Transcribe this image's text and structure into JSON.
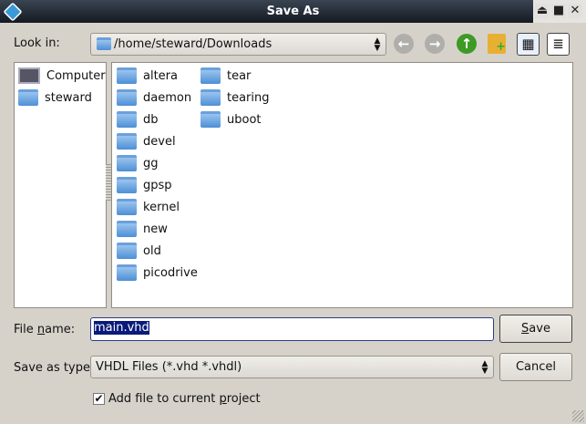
{
  "window": {
    "title": "Save As"
  },
  "look_in": {
    "label": "Look in:",
    "path": "/home/steward/Downloads"
  },
  "toolbar": {
    "back": "back-arrow-icon",
    "forward": "forward-arrow-icon",
    "up": "up-arrow-icon",
    "new_folder": "new-folder-icon",
    "icon_view": "grid-icon",
    "detail_view": "list-icon"
  },
  "places": [
    {
      "label": "Computer"
    },
    {
      "label": "steward"
    }
  ],
  "files": [
    {
      "name": "altera"
    },
    {
      "name": "daemon"
    },
    {
      "name": "db"
    },
    {
      "name": "devel"
    },
    {
      "name": "gg"
    },
    {
      "name": "gpsp"
    },
    {
      "name": "kernel"
    },
    {
      "name": "new"
    },
    {
      "name": "old"
    },
    {
      "name": "picodrive"
    },
    {
      "name": "tear"
    },
    {
      "name": "tearing"
    },
    {
      "name": "uboot"
    }
  ],
  "filename": {
    "label_pre": "File ",
    "label_u": "n",
    "label_post": "ame:",
    "value": "main.vhd"
  },
  "filetype": {
    "label": "Save as type:",
    "value": "VHDL Files (*.vhd *.vhdl)"
  },
  "buttons": {
    "save_u": "S",
    "save_rest": "ave",
    "cancel": "Cancel"
  },
  "checkbox": {
    "checked": true,
    "pre": "Add file to current ",
    "u": "p",
    "post": "roject"
  }
}
